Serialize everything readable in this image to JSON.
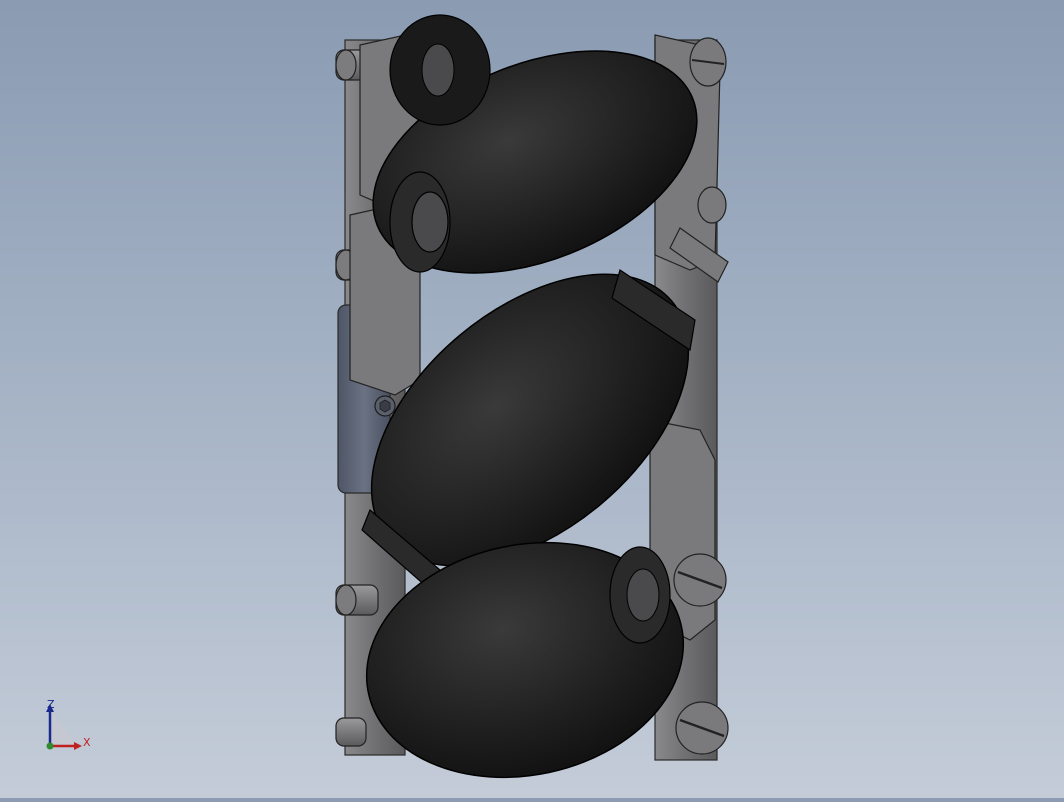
{
  "viewport": {
    "model": "mecanum-wheel-assembly",
    "background_top": "#8a9bb2",
    "background_bottom": "#c4ccd8",
    "roller_color": "#1f1f1f",
    "frame_color": "#6e6e70",
    "hub_color": "#5d6472"
  },
  "triad": {
    "z_label": "Z",
    "x_label": "X",
    "z_color": "#1a2a8c",
    "x_color": "#c02020",
    "origin_color": "#2e8b2e"
  }
}
